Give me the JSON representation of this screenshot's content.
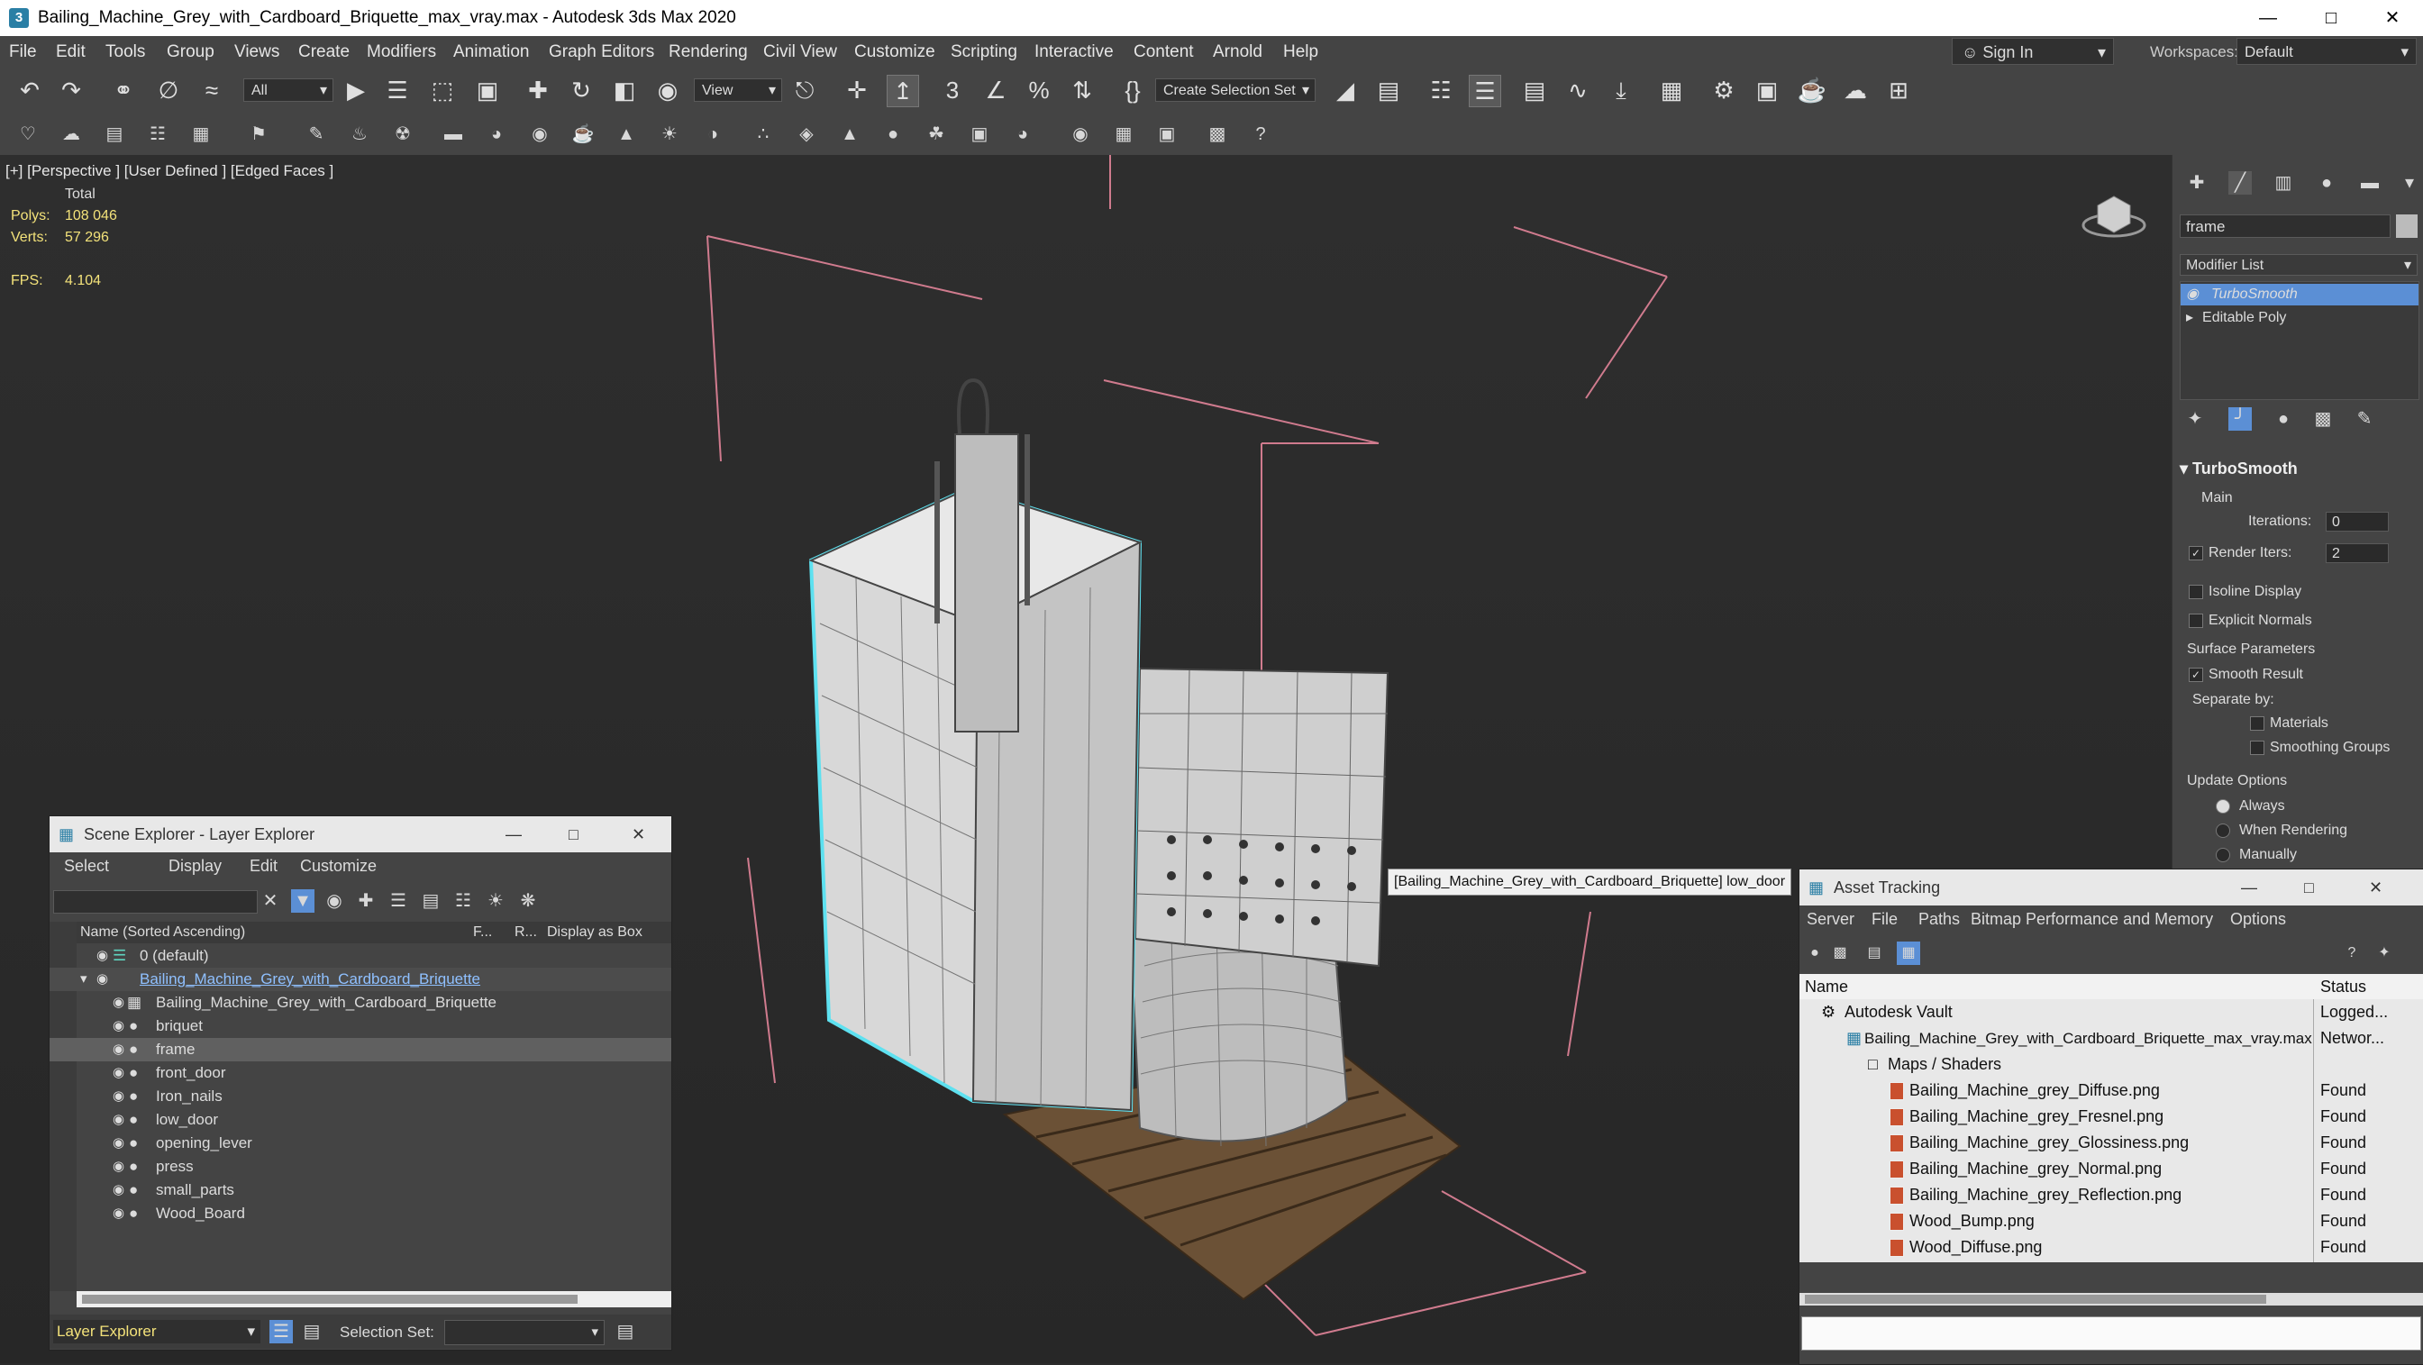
{
  "window": {
    "title": "Bailing_Machine_Grey_with_Cardboard_Briquette_max_vray.max - Autodesk 3ds Max 2020",
    "app_icon": "3"
  },
  "menu": [
    "File",
    "Edit",
    "Tools",
    "Group",
    "Views",
    "Create",
    "Modifiers",
    "Animation",
    "Graph Editors",
    "Rendering",
    "Civil View",
    "Customize",
    "Scripting",
    "Interactive",
    "Content",
    "Arnold",
    "Help"
  ],
  "account": {
    "sign_in": "Sign In",
    "workspaces_label": "Workspaces:",
    "workspace": "Default"
  },
  "toolbar": {
    "filter": "All",
    "ref_coord": "View",
    "selection_set": "Create Selection Set"
  },
  "viewport": {
    "label": "[+] [Perspective ] [User Defined ] [Edged Faces ]",
    "stats_header": "Total",
    "polys_label": "Polys:",
    "polys": "108 046",
    "verts_label": "Verts:",
    "verts": "57 296",
    "fps_label": "FPS:",
    "fps": "4.104",
    "tooltip": "[Bailing_Machine_Grey_with_Cardboard_Briquette] low_door"
  },
  "command_panel": {
    "object_name": "frame",
    "modifier_list": "Modifier List",
    "stack": [
      "TurboSmooth",
      "Editable Poly"
    ],
    "rollout_title": "TurboSmooth",
    "main": "Main",
    "iterations_label": "Iterations:",
    "iterations": "0",
    "render_iters_label": "Render Iters:",
    "render_iters": "2",
    "isoline": "Isoline Display",
    "explicit_normals": "Explicit Normals",
    "surface_params": "Surface Parameters",
    "smooth_result": "Smooth Result",
    "separate_by": "Separate by:",
    "materials": "Materials",
    "smoothing_groups": "Smoothing Groups",
    "update_options": "Update Options",
    "always": "Always",
    "when_rendering": "When Rendering",
    "manually": "Manually"
  },
  "scene_explorer": {
    "title": "Scene Explorer - Layer Explorer",
    "menu": [
      "Select",
      "Display",
      "Edit",
      "Customize"
    ],
    "col_name": "Name (Sorted Ascending)",
    "col_f": "F...",
    "col_r": "R...",
    "col_box": "Display as Box",
    "rows": [
      {
        "name": "0 (default)"
      },
      {
        "name": "Bailing_Machine_Grey_with_Cardboard_Briquette"
      },
      {
        "name": "Bailing_Machine_Grey_with_Cardboard_Briquette"
      },
      {
        "name": "briquet"
      },
      {
        "name": "frame"
      },
      {
        "name": "front_door"
      },
      {
        "name": "Iron_nails"
      },
      {
        "name": "low_door"
      },
      {
        "name": "opening_lever"
      },
      {
        "name": "press"
      },
      {
        "name": "small_parts"
      },
      {
        "name": "Wood_Board"
      }
    ],
    "footer_explorer": "Layer Explorer",
    "footer_selection_label": "Selection Set:"
  },
  "asset_tracking": {
    "title": "Asset Tracking",
    "menu": [
      "Server",
      "File",
      "Paths",
      "Bitmap Performance and Memory",
      "Options"
    ],
    "col_name": "Name",
    "col_status": "Status",
    "rows": [
      {
        "name": "Autodesk Vault",
        "status": "Logged..."
      },
      {
        "name": "Bailing_Machine_Grey_with_Cardboard_Briquette_max_vray.max",
        "status": "Networ..."
      },
      {
        "name": "Maps / Shaders",
        "status": ""
      },
      {
        "name": "Bailing_Machine_grey_Diffuse.png",
        "status": "Found"
      },
      {
        "name": "Bailing_Machine_grey_Fresnel.png",
        "status": "Found"
      },
      {
        "name": "Bailing_Machine_grey_Glossiness.png",
        "status": "Found"
      },
      {
        "name": "Bailing_Machine_grey_Normal.png",
        "status": "Found"
      },
      {
        "name": "Bailing_Machine_grey_Reflection.png",
        "status": "Found"
      },
      {
        "name": "Wood_Bump.png",
        "status": "Found"
      },
      {
        "name": "Wood_Diffuse.png",
        "status": "Found"
      }
    ]
  },
  "colors": {
    "accent": "#5b9bd5",
    "selection": "#2f6fbf",
    "highlight": "#5ee1f0",
    "stats": "#f3e27a"
  }
}
